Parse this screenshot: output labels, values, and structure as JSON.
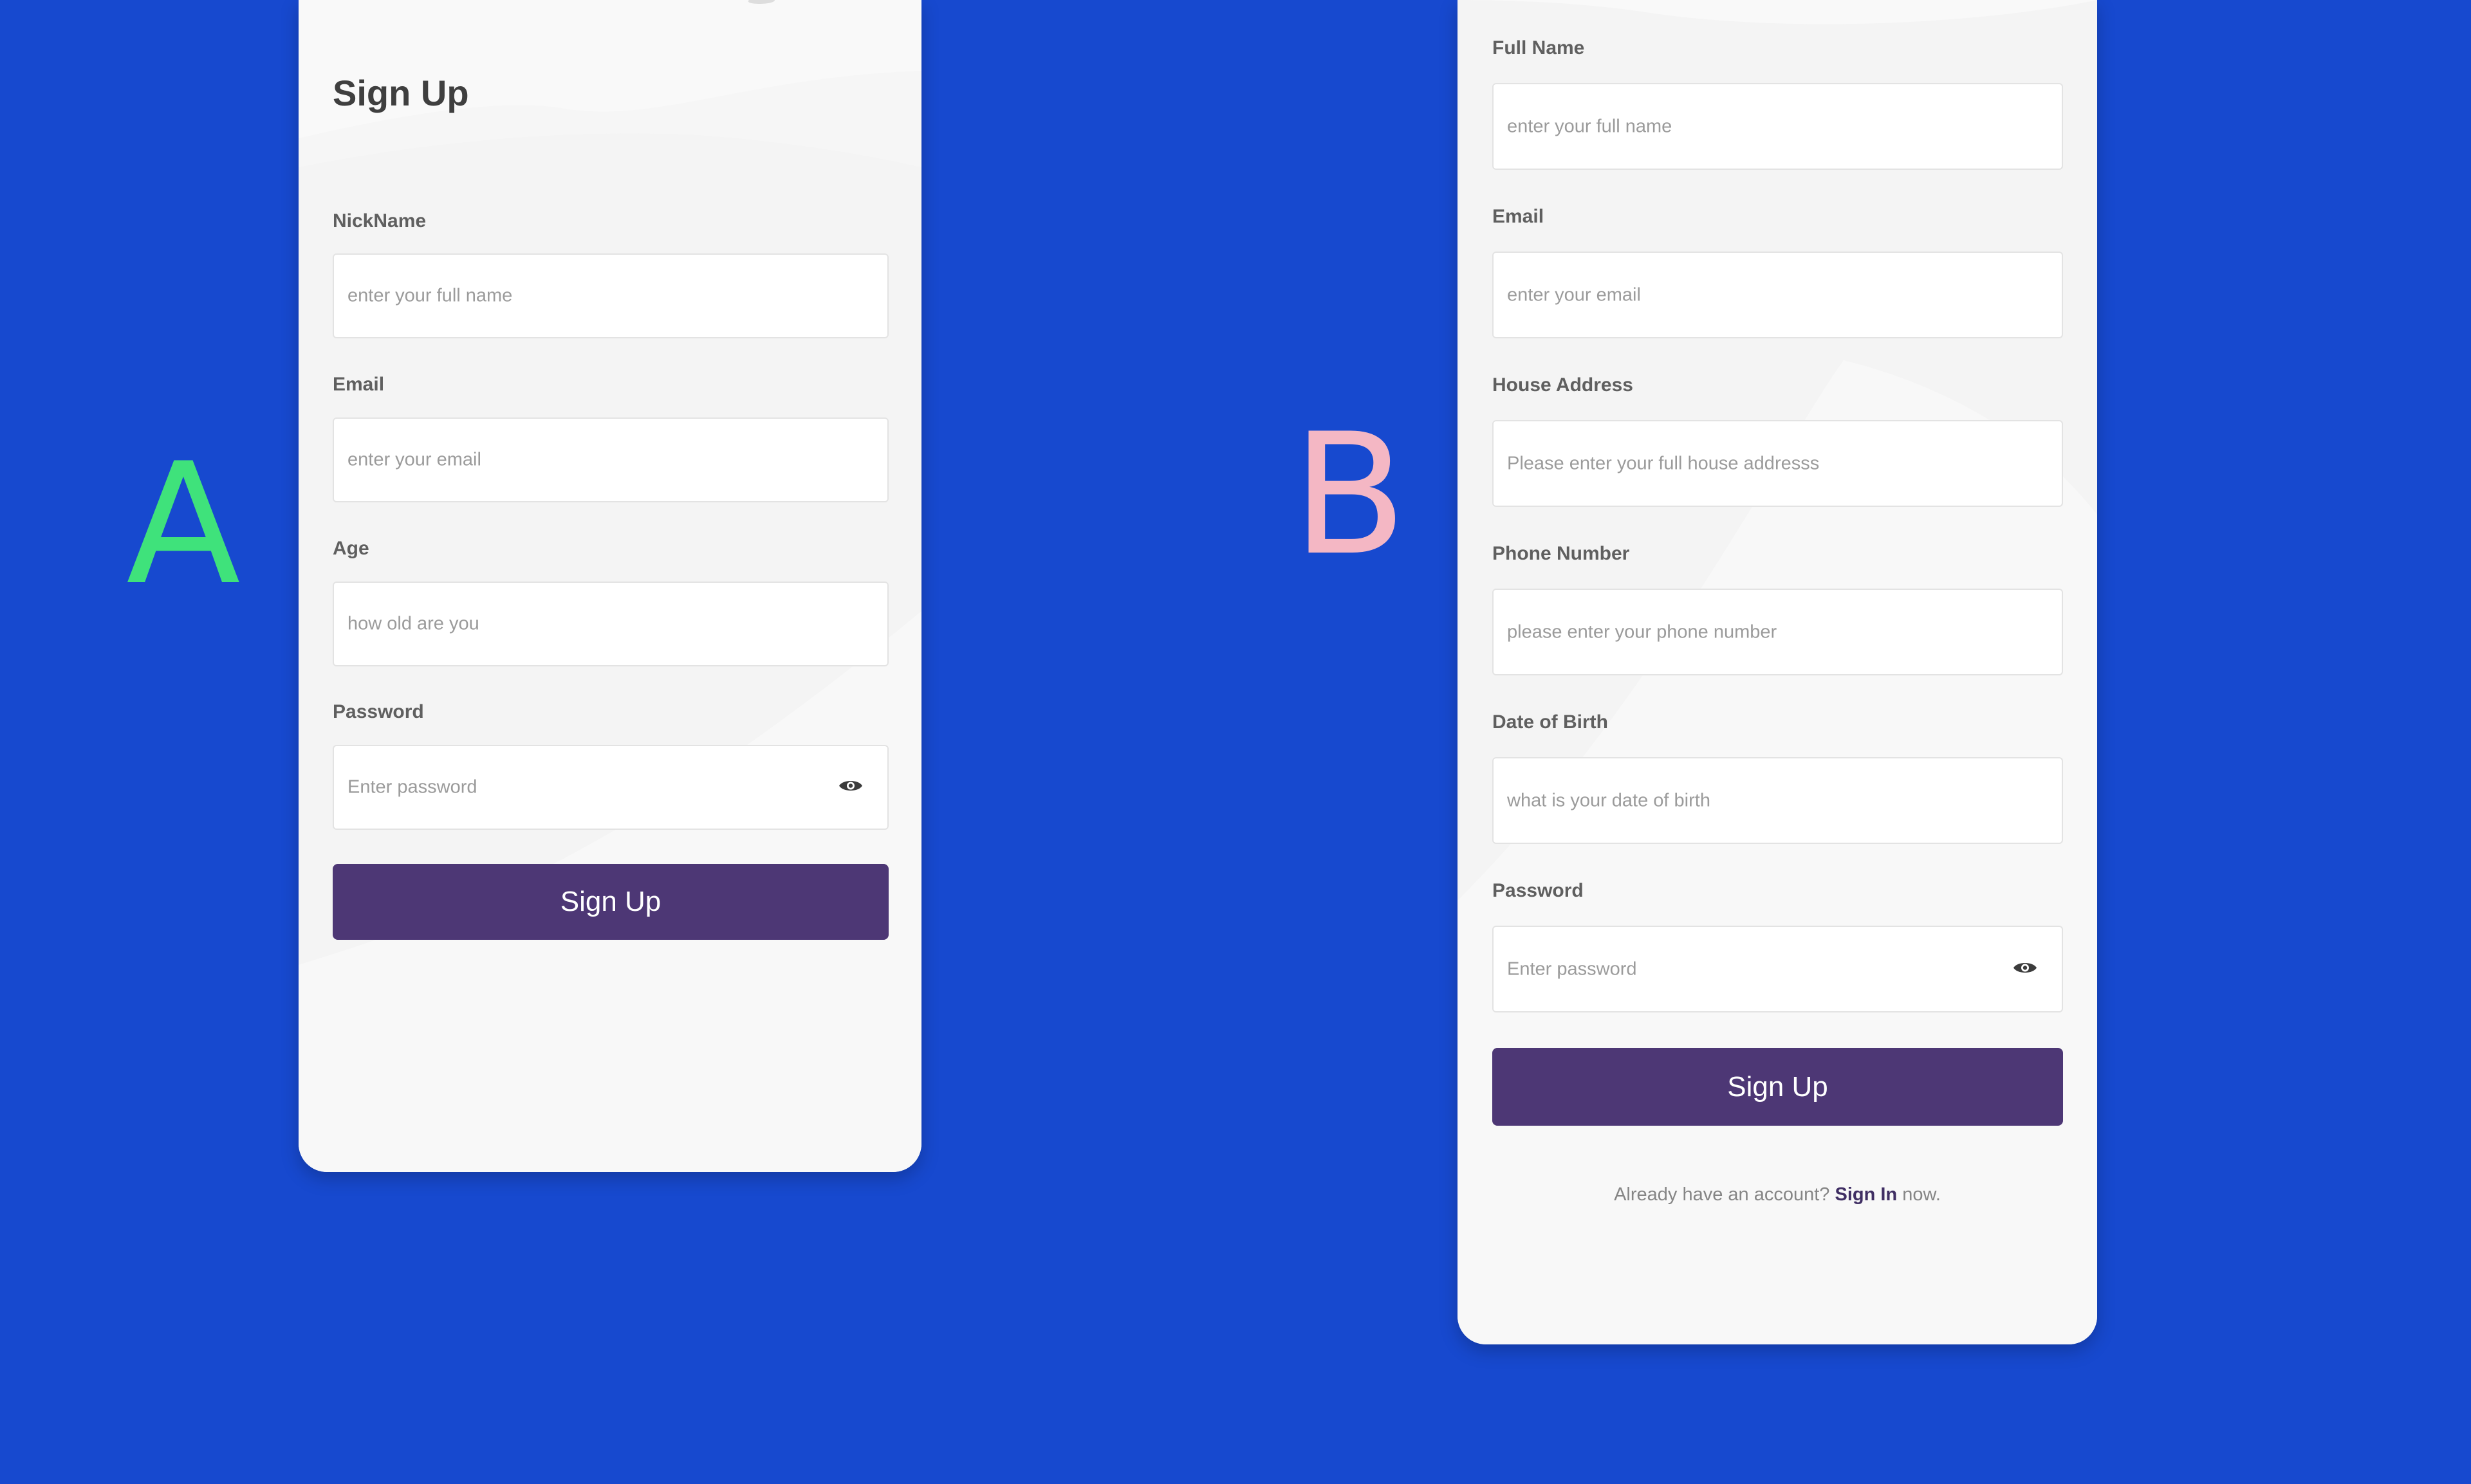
{
  "variants": {
    "a_letter": "A",
    "b_letter": "B",
    "a_color": "#3FE27B",
    "b_color": "#F4B7C4"
  },
  "colors": {
    "background": "#1749CF",
    "card": "#F4F4F4",
    "button": "#4D3775",
    "link": "#3F2E63"
  },
  "form_a": {
    "title": "Sign Up",
    "fields": [
      {
        "label": "NickName",
        "placeholder": "enter your full name"
      },
      {
        "label": "Email",
        "placeholder": "enter your email"
      },
      {
        "label": "Age",
        "placeholder": "how old are you"
      },
      {
        "label": "Password",
        "placeholder": "Enter password",
        "icon": "eye-icon"
      }
    ],
    "submit_label": "Sign Up"
  },
  "form_b": {
    "fields": [
      {
        "label": "Full Name",
        "placeholder": "enter your full name"
      },
      {
        "label": "Email",
        "placeholder": "enter your email"
      },
      {
        "label": "House Address",
        "placeholder": "Please enter your full house addresss"
      },
      {
        "label": "Phone Number",
        "placeholder": "please enter your phone number"
      },
      {
        "label": "Date of Birth",
        "placeholder": "what is your date of birth"
      },
      {
        "label": "Password",
        "placeholder": "Enter password",
        "icon": "eye-icon"
      }
    ],
    "submit_label": "Sign Up",
    "footer": {
      "prefix": "Already have an account?",
      "link": "Sign In",
      "suffix": "now."
    }
  }
}
